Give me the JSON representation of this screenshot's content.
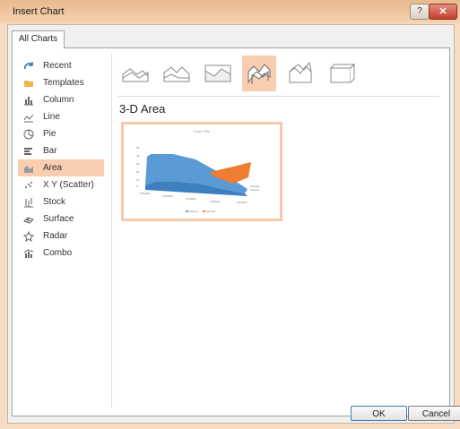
{
  "window": {
    "title": "Insert Chart",
    "help_label": "?",
    "close_label": "✕"
  },
  "tab": {
    "label": "All Charts"
  },
  "chart_types": [
    {
      "label": "Recent",
      "icon": "recent-icon"
    },
    {
      "label": "Templates",
      "icon": "folder-icon"
    },
    {
      "label": "Column",
      "icon": "column-chart-icon"
    },
    {
      "label": "Line",
      "icon": "line-chart-icon"
    },
    {
      "label": "Pie",
      "icon": "pie-chart-icon"
    },
    {
      "label": "Bar",
      "icon": "bar-chart-icon"
    },
    {
      "label": "Area",
      "icon": "area-chart-icon",
      "selected": true
    },
    {
      "label": "X Y (Scatter)",
      "icon": "scatter-chart-icon"
    },
    {
      "label": "Stock",
      "icon": "stock-chart-icon"
    },
    {
      "label": "Surface",
      "icon": "surface-chart-icon"
    },
    {
      "label": "Radar",
      "icon": "radar-chart-icon"
    },
    {
      "label": "Combo",
      "icon": "combo-chart-icon"
    }
  ],
  "subtype": {
    "title": "3-D Area"
  },
  "preview": {
    "chart_title": "Chart Title",
    "y_ticks": [
      "50",
      "40",
      "30",
      "20",
      "10",
      "0"
    ],
    "dates": [
      "1/5/2002",
      "1/6/2002",
      "1/7/2002",
      "1/8/2002",
      "1/9/2002"
    ],
    "series_labels": [
      "Series2",
      "Series1"
    ],
    "legend": [
      "Series1",
      "Series2"
    ]
  },
  "buttons": {
    "ok": "OK",
    "cancel": "Cancel"
  },
  "colors": {
    "accent": "#f8cdb0",
    "series1": "#5b9bd5",
    "series2": "#ed7d31"
  }
}
